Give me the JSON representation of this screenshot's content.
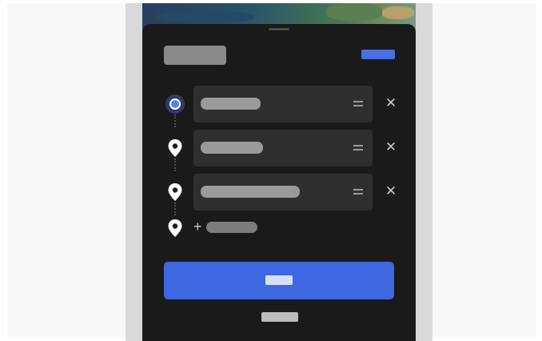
{
  "header": {
    "title": "",
    "done_label": ""
  },
  "stops": [
    {
      "label": "",
      "type": "origin"
    },
    {
      "label": "",
      "type": "destination"
    },
    {
      "label": "",
      "type": "destination"
    }
  ],
  "add_stop": {
    "label": ""
  },
  "primary_action": {
    "label": ""
  },
  "secondary_action": {
    "label": ""
  },
  "icons": {
    "origin": "origin-dot-icon",
    "stop": "map-pin-icon",
    "reorder": "drag-handle-icon",
    "remove": "close-icon",
    "add": "plus-icon"
  },
  "colors": {
    "sheet": "#1a1a1a",
    "field": "#2f2f2f",
    "accent": "#3f67e0",
    "origin_ring": "#2f3d66"
  }
}
